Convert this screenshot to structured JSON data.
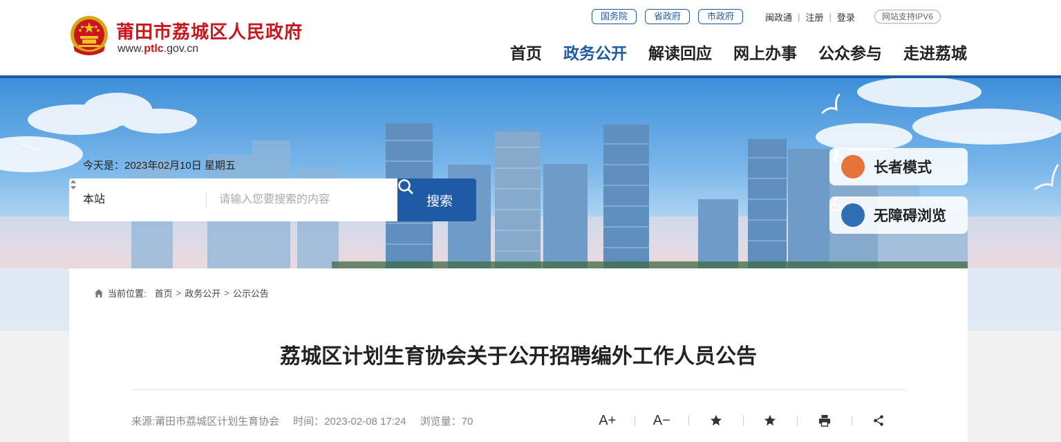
{
  "header": {
    "site_name": "莆田市荔城区人民政府",
    "url_prefix": "www.",
    "url_highlight": "ptlc",
    "url_suffix": ".gov.cn",
    "top_links": [
      "国务院",
      "省政府",
      "市政府"
    ],
    "user_links": [
      "闽政通",
      "注册",
      "登录"
    ],
    "ipv6_badge": "网站支持IPV6",
    "nav": [
      "首页",
      "政务公开",
      "解读回应",
      "网上办事",
      "公众参与",
      "走进荔城"
    ],
    "active_nav": "政务公开"
  },
  "banner": {
    "date_text": "今天是：2023年02月10日 星期五",
    "search": {
      "scope": "本站",
      "placeholder": "请输入您要搜索的内容",
      "button": "搜索"
    },
    "elder_mode": "长者模式",
    "accessible_mode": "无障碍浏览"
  },
  "breadcrumb": {
    "label": "当前位置:",
    "items": [
      "首页",
      "政务公开",
      "公示公告"
    ]
  },
  "article": {
    "title": "荔城区计划生育协会关于公开招聘编外工作人员公告",
    "source": "来源:莆田市荔城区计划生育协会",
    "time": "时间：2023-02-08 17:24",
    "views": "浏览量：70"
  },
  "tools": {
    "font_larger": "A+",
    "font_smaller": "A−"
  },
  "colors": {
    "brand_red": "#c8161d",
    "brand_blue": "#1f5aa6",
    "elder_orange": "#e8733a",
    "accessible_blue": "#2f6db5"
  }
}
